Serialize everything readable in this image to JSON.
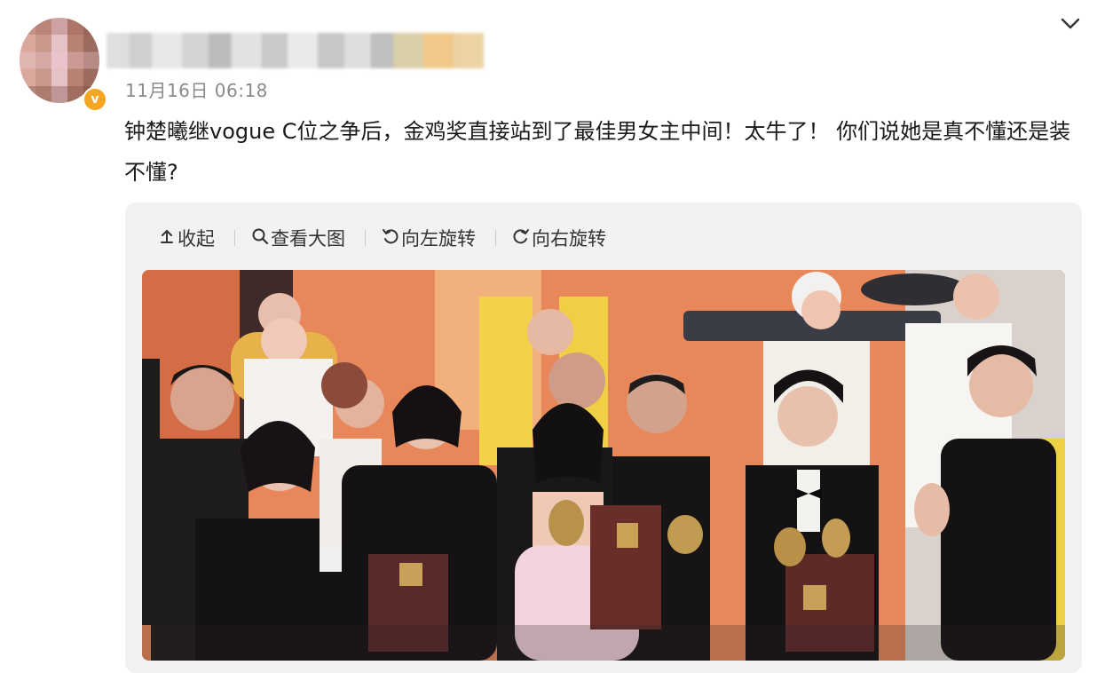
{
  "post": {
    "timestamp": "11月16日 06:18",
    "text": "钟楚曦继vogue C位之争后，金鸡奖直接站到了最佳男女主中间！太牛了！ 你们说她是真不懂还是装不懂?"
  },
  "header": {
    "menu_icon": "chevron-down-icon",
    "verified_badge": "v"
  },
  "image_toolbar": {
    "collapse": {
      "icon": "↥",
      "label": "收起"
    },
    "view_large": {
      "icon": "🔍︎",
      "label": "查看大图"
    },
    "rotate_left": {
      "icon": "↺",
      "label": "向左旋转"
    },
    "rotate_right": {
      "icon": "↻",
      "label": "向右旋转"
    }
  },
  "colors": {
    "accent_badge": "#f5a623",
    "stage_orange": "#e98a57",
    "card_bg": "#f2f2f2"
  }
}
